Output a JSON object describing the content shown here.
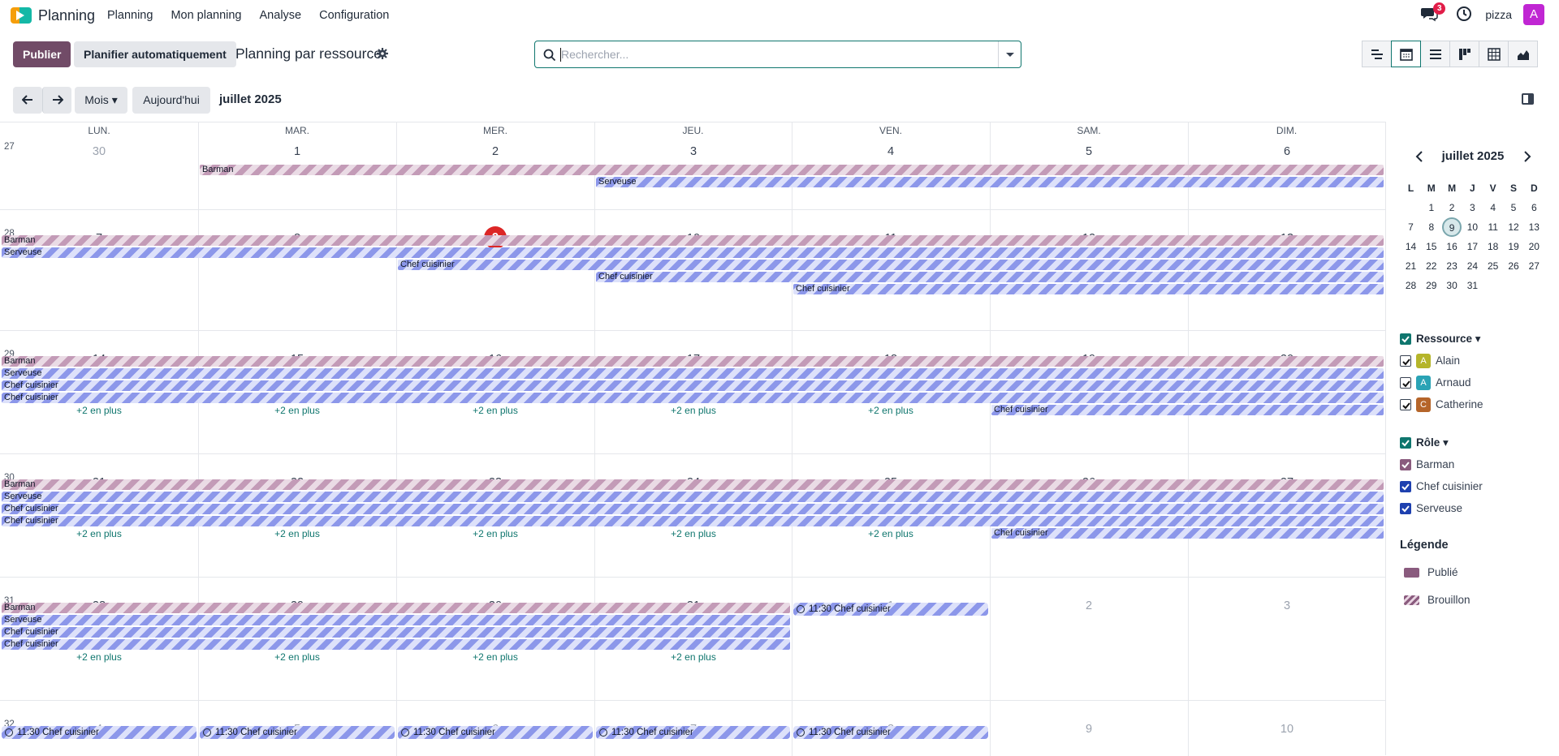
{
  "app": {
    "name": "Planning",
    "menu": [
      "Planning",
      "Mon planning",
      "Analyse",
      "Configuration"
    ],
    "company": "pizza",
    "avatar_letter": "A",
    "messages_count": "3"
  },
  "control": {
    "publish": "Publier",
    "auto_plan": "Planifier automatiquement",
    "title": "Planning par ressource",
    "search_placeholder": "Rechercher...",
    "views": [
      "gantt-icon",
      "calendar-icon",
      "list-icon",
      "kanban-icon",
      "pivot-icon",
      "graph-icon"
    ],
    "scale": "Mois",
    "today": "Aujourd'hui",
    "period": "juillet 2025"
  },
  "calendar": {
    "weekdays": [
      "LUN.",
      "MAR.",
      "MER.",
      "JEU.",
      "VEN.",
      "SAM.",
      "DIM."
    ],
    "weeks": [
      {
        "num": "27",
        "days": [
          "30",
          "1",
          "2",
          "3",
          "4",
          "5",
          "6"
        ]
      },
      {
        "num": "28",
        "days": [
          "7",
          "8",
          "9",
          "10",
          "11",
          "12",
          "13"
        ]
      },
      {
        "num": "29",
        "days": [
          "14",
          "15",
          "16",
          "17",
          "18",
          "19",
          "20"
        ]
      },
      {
        "num": "30",
        "days": [
          "21",
          "22",
          "23",
          "24",
          "25",
          "26",
          "27"
        ]
      },
      {
        "num": "31",
        "days": [
          "28",
          "29",
          "30",
          "31",
          "1",
          "2",
          "3"
        ]
      },
      {
        "num": "32",
        "days": [
          "4",
          "5",
          "6",
          "7",
          "8",
          "9",
          "10"
        ]
      }
    ],
    "today": "9",
    "more_label": "+2 en plus",
    "event_labels": {
      "barman": "Barman",
      "serveuse": "Serveuse",
      "chef": "Chef cuisinier",
      "timed_chef": "11:30 Chef cuisinier"
    }
  },
  "sidebar": {
    "month": "juillet 2025",
    "weekday_initials": [
      "L",
      "M",
      "M",
      "J",
      "V",
      "S",
      "D"
    ],
    "weeks": [
      [
        "",
        "1",
        "2",
        "3",
        "4",
        "5",
        "6"
      ],
      [
        "7",
        "8",
        "9",
        "10",
        "11",
        "12",
        "13"
      ],
      [
        "14",
        "15",
        "16",
        "17",
        "18",
        "19",
        "20"
      ],
      [
        "21",
        "22",
        "23",
        "24",
        "25",
        "26",
        "27"
      ],
      [
        "28",
        "29",
        "30",
        "31",
        "",
        "",
        ""
      ]
    ],
    "resource_title": "Ressource",
    "resources": [
      {
        "initial": "A",
        "name": "Alain",
        "color": "#b5b52a"
      },
      {
        "initial": "A",
        "name": "Arnaud",
        "color": "#2aa3b5"
      },
      {
        "initial": "C",
        "name": "Catherine",
        "color": "#b5652a"
      }
    ],
    "role_title": "Rôle",
    "roles": [
      "Barman",
      "Chef cuisinier",
      "Serveuse"
    ],
    "legend_title": "Légende",
    "legend": [
      "Publié",
      "Brouillon"
    ]
  }
}
